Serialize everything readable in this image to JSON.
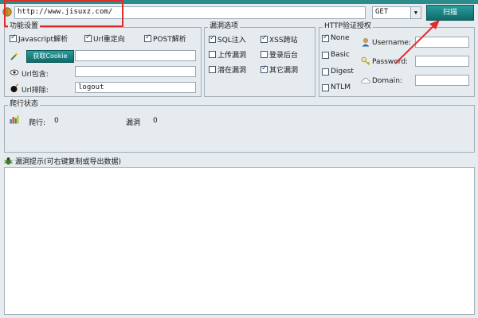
{
  "window": {
    "accent": "#2b8c8c",
    "highlight": "#e02b2b"
  },
  "toolbar": {
    "url_value": "http://www.jisuxz.com/",
    "method_value": "GET",
    "scan_label": "扫描"
  },
  "basic": {
    "title": "功能设置",
    "javascript": "Javascript解析",
    "url_redirect": "Url重定向",
    "post": "POST解析",
    "cookie_button": "获取Cookie",
    "url_include_label": "Url包含:",
    "url_exclude_label": "Url排除:",
    "url_exclude_value": "logout"
  },
  "vuln_options": {
    "title": "漏洞选项",
    "sql": "SQL注入",
    "xss": "XSS跨站",
    "upload": "上传漏洞",
    "login": "登录后台",
    "potential": "潜在漏洞",
    "other": "其它漏洞"
  },
  "http_auth": {
    "title": "HTTP验证授权",
    "none": "None",
    "basic": "Basic",
    "digest": "Digest",
    "ntlm": "NTLM",
    "username_label": "Username:",
    "password_label": "Password:",
    "domain_label": "Domain:"
  },
  "crawl_status": {
    "title": "爬行状态",
    "crawled_label": "爬行:",
    "crawled_value": "0",
    "vuln_label": "漏洞",
    "vuln_value": "0"
  },
  "vuln_display": {
    "title": "漏洞提示(可右键复制或导出数据)"
  }
}
